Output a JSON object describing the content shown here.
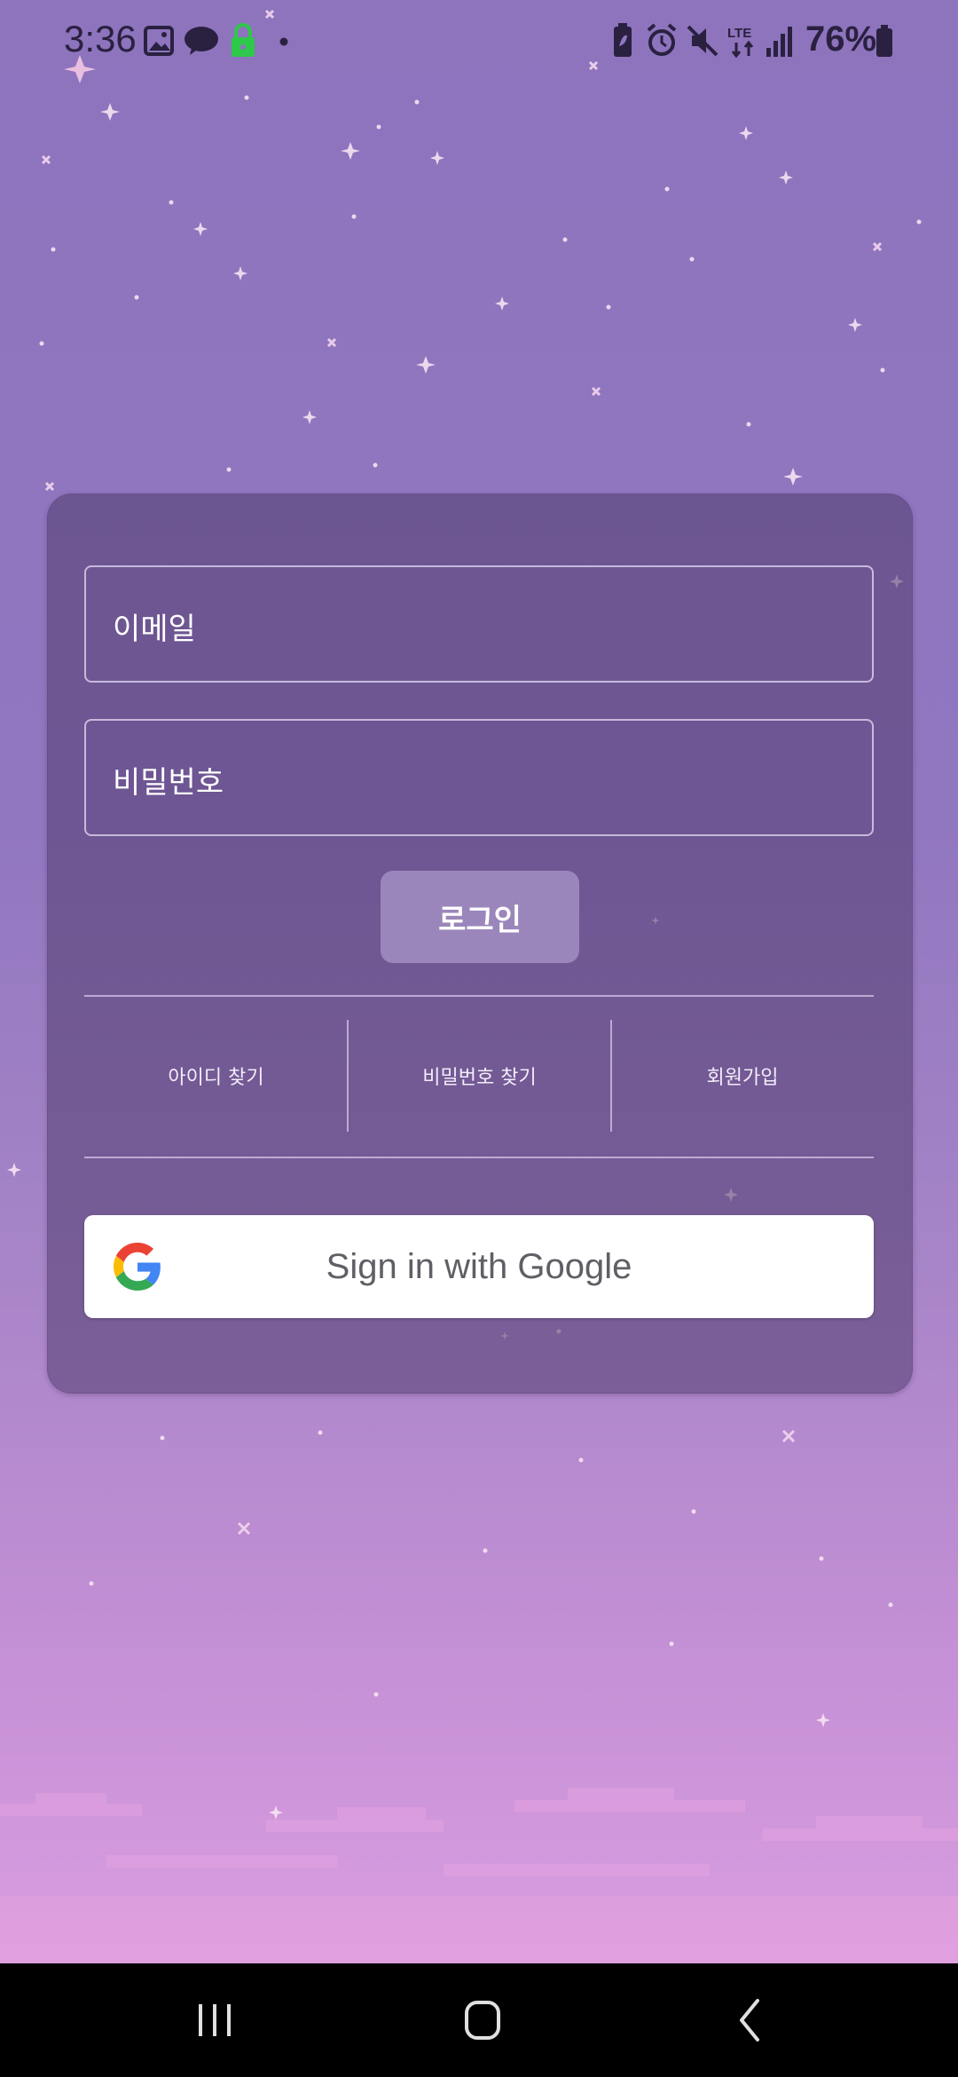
{
  "status_bar": {
    "time": "3:36",
    "battery_percent": "76%",
    "network": "LTE",
    "icons": [
      "gallery-icon",
      "kakaotalk-icon",
      "lock-icon",
      "dot-icon",
      "battery-saver-icon",
      "alarm-icon",
      "mute-icon",
      "lte-icon",
      "signal-icon",
      "battery-icon"
    ]
  },
  "login_form": {
    "email_placeholder": "이메일",
    "password_placeholder": "비밀번호",
    "login_label": "로그인",
    "links": {
      "find_id": "아이디 찾기",
      "find_password": "비밀번호 찾기",
      "signup": "회원가입"
    },
    "google_label": "Sign in with Google"
  },
  "navigation_bar": {
    "buttons": [
      "recents-icon",
      "home-icon",
      "back-icon"
    ]
  },
  "colors": {
    "sky_top": "#8d74bd",
    "sky_bottom": "#e1a2e4",
    "card": "#5a4378",
    "login_button": "#aa96c8",
    "google_button": "#ffffff"
  }
}
